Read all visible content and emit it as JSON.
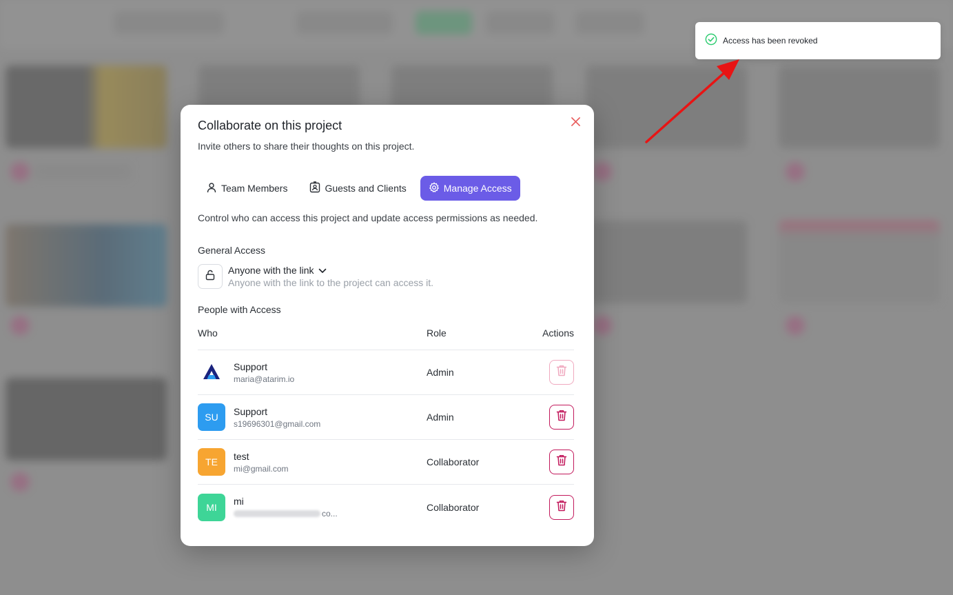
{
  "toast": {
    "message": "Access has been revoked",
    "icon": "check-circle-icon",
    "accent": "#2ecc71"
  },
  "modal": {
    "title": "Collaborate on this project",
    "subtitle": "Invite others to share their thoughts on this project.",
    "close_icon": "close-icon",
    "tabs": [
      {
        "label": "Team Members",
        "icon": "user-icon",
        "active": false
      },
      {
        "label": "Guests and Clients",
        "icon": "id-badge-icon",
        "active": false
      },
      {
        "label": "Manage Access",
        "icon": "gear-icon",
        "active": true
      }
    ],
    "accent_color": "#6b5ce7",
    "description": "Control who can access this project and update access permissions as needed.",
    "general_access": {
      "label": "General Access",
      "value": "Anyone with the link",
      "hint": "Anyone with the link to the project can access it."
    },
    "people": {
      "label": "People with Access",
      "columns": {
        "who": "Who",
        "role": "Role",
        "actions": "Actions"
      },
      "rows": [
        {
          "name": "Support",
          "email": "maria@atarim.io",
          "role": "Admin",
          "avatar": "",
          "avatar_color": "",
          "logo": true,
          "delete_disabled": true
        },
        {
          "name": "Support",
          "email": "s19696301@gmail.com",
          "role": "Admin",
          "avatar": "SU",
          "avatar_color": "#2d9cf0",
          "logo": false,
          "delete_disabled": false
        },
        {
          "name": "test",
          "email": "mi@gmail.com",
          "role": "Collaborator",
          "avatar": "TE",
          "avatar_color": "#f7a531",
          "logo": false,
          "delete_disabled": false
        },
        {
          "name": "mi",
          "email": "co...",
          "role": "Collaborator",
          "avatar": "MI",
          "avatar_color": "#3ed597",
          "logo": false,
          "delete_disabled": false,
          "email_blurred": true
        }
      ]
    },
    "delete_color": "#c2185b"
  }
}
